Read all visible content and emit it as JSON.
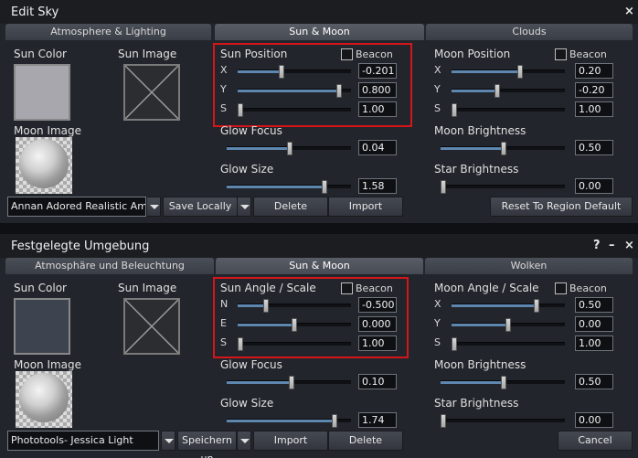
{
  "panel1": {
    "title": "Edit Sky",
    "close": "×",
    "tabs": [
      "Atmosphere & Lighting",
      "Sun & Moon",
      "Clouds"
    ],
    "sun_color_label": "Sun Color",
    "sun_image_label": "Sun Image",
    "moon_image_label": "Moon Image",
    "sun_position_label": "Sun Position",
    "beacon_label": "Beacon",
    "sun_axes": [
      "X",
      "Y",
      "S"
    ],
    "sun_values": [
      "-0.201",
      "0.800",
      "1.00"
    ],
    "glow_focus_label": "Glow Focus",
    "glow_focus_value": "0.04",
    "glow_size_label": "Glow Size",
    "glow_size_value": "1.58",
    "moon_position_label": "Moon Position",
    "moon_beacon_label": "Beacon",
    "moon_axes": [
      "X",
      "Y",
      "S"
    ],
    "moon_values": [
      "0.20",
      "-0.20",
      "1.00"
    ],
    "moon_brightness_label": "Moon Brightness",
    "moon_brightness_value": "0.50",
    "star_brightness_label": "Star Brightness",
    "star_brightness_value": "0.00",
    "preset": "Annan Adored Realistic Am",
    "save_locally": "Save Locally",
    "delete": "Delete",
    "import": "Import",
    "reset": "Reset To Region Default",
    "sun_color_hex": "#a8a7ae"
  },
  "panel2": {
    "title": "Festgelegte Umgebung",
    "help": "?",
    "minimize": "–",
    "close": "×",
    "tabs": [
      "Atmosphäre und Beleuchtung",
      "Sun & Moon",
      "Wolken"
    ],
    "sun_color_label": "Sun Color",
    "sun_image_label": "Sun Image",
    "moon_image_label": "Moon Image",
    "sun_position_label": "Sun Angle / Scale",
    "beacon_label": "Beacon",
    "sun_axes": [
      "N",
      "E",
      "S"
    ],
    "sun_values": [
      "-0.500",
      "0.000",
      "1.00"
    ],
    "glow_focus_label": "Glow Focus",
    "glow_focus_value": "0.10",
    "glow_size_label": "Glow Size",
    "glow_size_value": "1.74",
    "moon_position_label": "Moon Angle / Scale",
    "moon_beacon_label": "Beacon",
    "moon_axes": [
      "X",
      "Y",
      "S"
    ],
    "moon_values": [
      "0.50",
      "0.00",
      "1.00"
    ],
    "moon_brightness_label": "Moon Brightness",
    "moon_brightness_value": "0.50",
    "star_brightness_label": "Star Brightness",
    "star_brightness_value": "0.00",
    "preset": "Phototools- Jessica Light",
    "save_locally": "Speichern un",
    "import": "Import",
    "delete": "Delete",
    "cancel": "Cancel",
    "sun_color_hex": "#3e4350"
  },
  "accent_hex": "#5e87b0",
  "highlight_hex": "#d4161a"
}
